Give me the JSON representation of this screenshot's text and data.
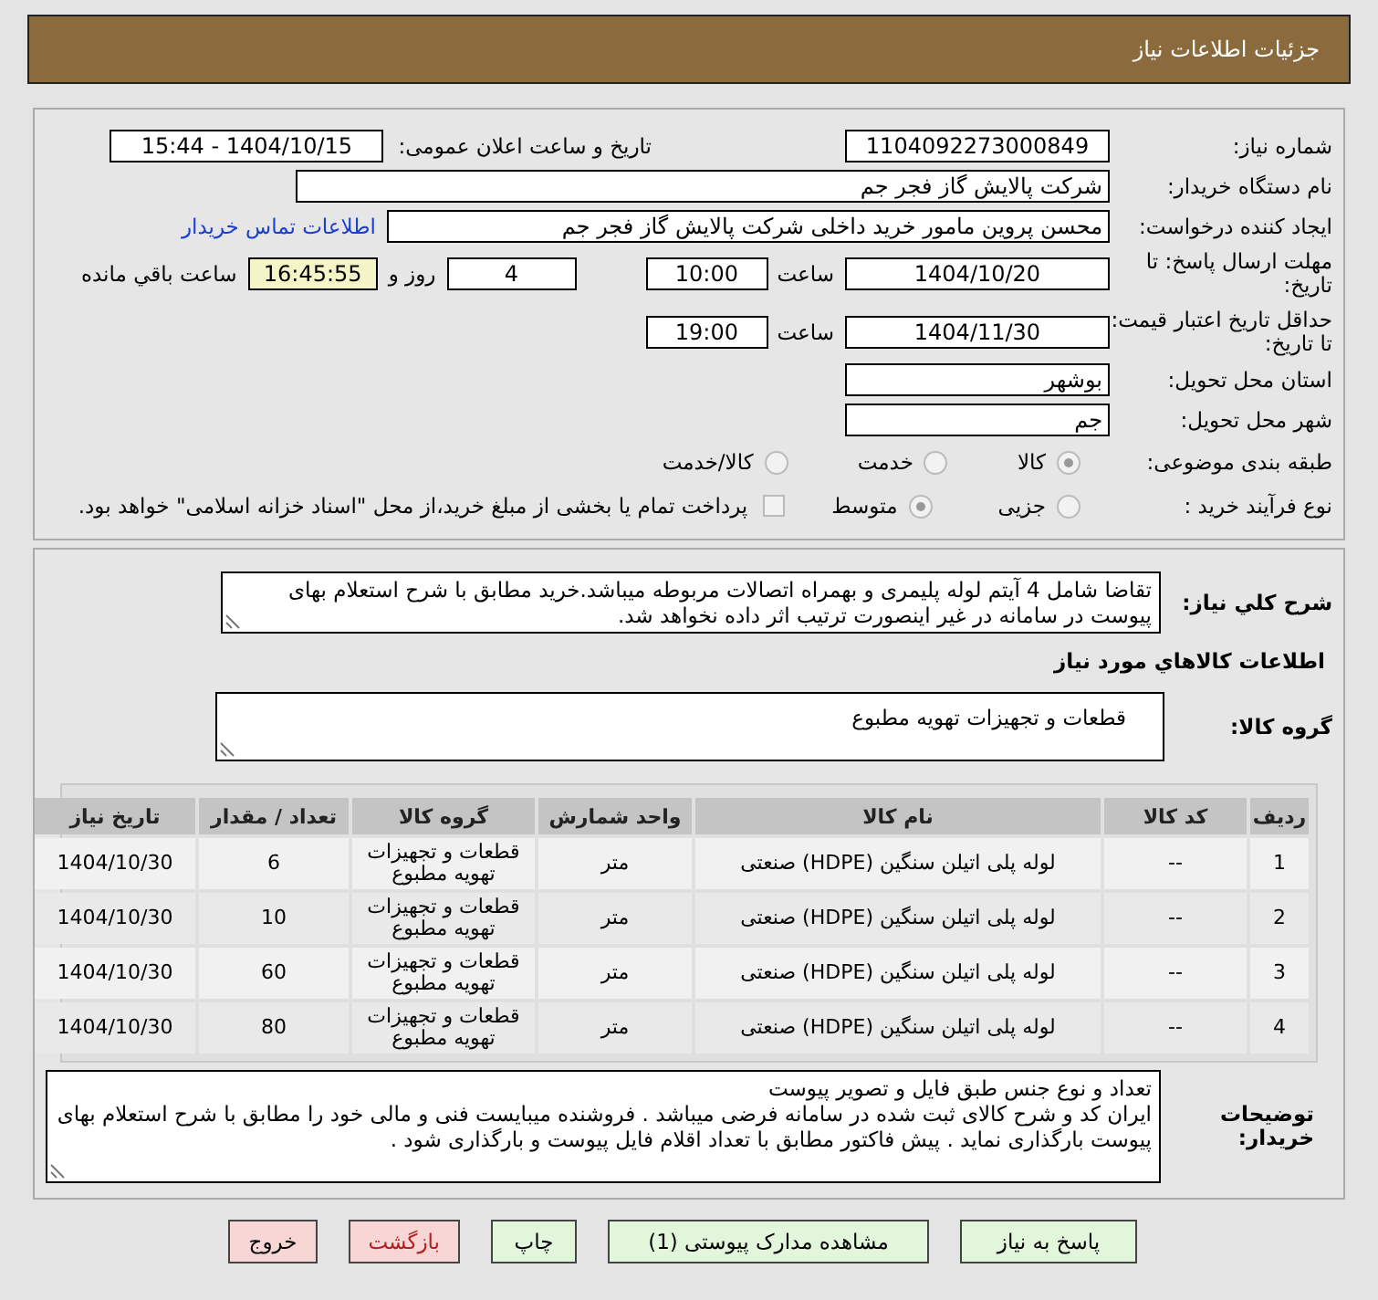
{
  "header": {
    "title": "جزئیات اطلاعات نیاز"
  },
  "need_number": {
    "label": "شماره نیاز:",
    "value": "1104092273000849"
  },
  "announce": {
    "label": "تاریخ و ساعت اعلان عمومی:",
    "value": "1404/10/15 - 15:44"
  },
  "buyer": {
    "label": "نام دستگاه خریدار:",
    "value": "شرکت پالایش گاز فجر جم"
  },
  "requester": {
    "label": "ایجاد کننده درخواست:",
    "value": "محسن پروین مامور خرید داخلی شرکت پالایش گاز فجر جم",
    "link": "اطلاعات تماس خریدار"
  },
  "deadline": {
    "label": "مهلت ارسال پاسخ: تا تاریخ:",
    "date": "1404/10/20",
    "time_label": "ساعت",
    "time": "10:00",
    "days": "4",
    "days_label": "روز و",
    "remaining": "16:45:55",
    "remaining_label": "ساعت باقي مانده"
  },
  "validity": {
    "label": "حداقل تاریخ اعتبار قیمت: تا تاریخ:",
    "date": "1404/11/30",
    "time_label": "ساعت",
    "time": "19:00"
  },
  "province": {
    "label": "استان محل تحویل:",
    "value": "بوشهر"
  },
  "city": {
    "label": "شهر محل تحویل:",
    "value": "جم"
  },
  "category": {
    "label": "طبقه بندی موضوعی:",
    "options": [
      {
        "label": "کالا",
        "selected": true
      },
      {
        "label": "خدمت",
        "selected": false
      },
      {
        "label": "کالا/خدمت",
        "selected": false
      }
    ]
  },
  "process": {
    "label": "نوع فرآیند خرید :",
    "options": [
      {
        "label": "جزیی",
        "selected": false
      },
      {
        "label": "متوسط",
        "selected": true
      }
    ],
    "payment": {
      "checked": false,
      "text": "پرداخت تمام یا بخشی از مبلغ خرید،از محل \"اسناد خزانه اسلامی\" خواهد بود."
    }
  },
  "description": {
    "label": "شرح کلي نياز:",
    "text": "تقاضا  شامل 4 آیتم لوله پلیمری و بهمراه اتصالات مربوطه میباشد.خرید مطابق با شرح استعلام بهای پیوست در سامانه در غیر اینصورت ترتیب اثر داده نخواهد شد."
  },
  "items_title": "اطلاعات کالاهاي مورد نياز",
  "goods_group": {
    "label": "گروه کالا:",
    "value": "قطعات و تجهیزات تهویه مطبوع"
  },
  "table": {
    "columns": [
      "ردیف",
      "کد کالا",
      "نام کالا",
      "واحد شمارش",
      "گروه کالا",
      "تعداد / مقدار",
      "تاریخ نیاز"
    ],
    "rows": [
      [
        "1",
        "--",
        "لوله پلی اتیلن سنگین (HDPE) صنعتی",
        "متر",
        "قطعات و تجهیزات تهویه مطبوع",
        "6",
        "1404/10/30"
      ],
      [
        "2",
        "--",
        "لوله پلی اتیلن سنگین (HDPE) صنعتی",
        "متر",
        "قطعات و تجهیزات تهویه مطبوع",
        "10",
        "1404/10/30"
      ],
      [
        "3",
        "--",
        "لوله پلی اتیلن سنگین (HDPE) صنعتی",
        "متر",
        "قطعات و تجهیزات تهویه مطبوع",
        "60",
        "1404/10/30"
      ],
      [
        "4",
        "--",
        "لوله پلی اتیلن سنگین (HDPE) صنعتی",
        "متر",
        "قطعات و تجهیزات تهویه مطبوع",
        "80",
        "1404/10/30"
      ]
    ]
  },
  "notes": {
    "label": "توضیحات خریدار:",
    "text": "تعداد و نوع جنس طبق فایل و تصویر پیوست\nایران کد و شرح کالای ثبت شده در سامانه فرضی میباشد . فروشنده میبایست فنی و مالی خود را مطابق با شرح استعلام بهای پیوست بارگذاری نماید . پیش فاکتور مطابق با تعداد اقلام فایل پیوست و بارگذاری شود ."
  },
  "buttons": [
    {
      "label": "پاسخ به نیاز",
      "kind": "action"
    },
    {
      "label": "مشاهده مدارک پیوستی (1)",
      "kind": "action"
    },
    {
      "label": "چاپ",
      "kind": "action"
    },
    {
      "label": "بازگشت",
      "kind": "back"
    },
    {
      "label": "خروج",
      "kind": "exit"
    }
  ]
}
